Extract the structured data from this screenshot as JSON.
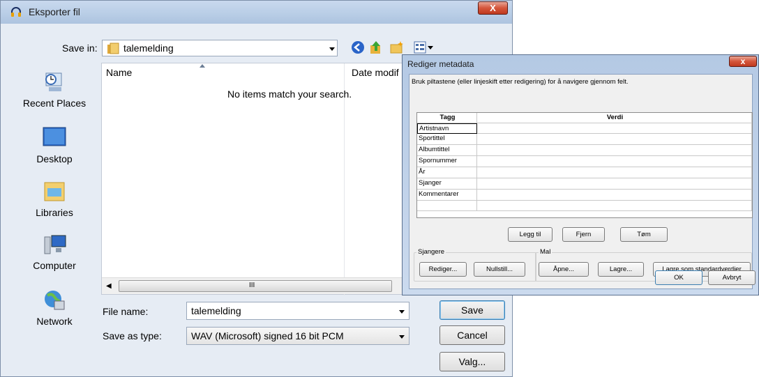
{
  "export_dialog": {
    "title": "Eksporter fil",
    "close_label": "X",
    "save_in_label": "Save in:",
    "save_in_value": "talemelding",
    "nav": [
      {
        "label": "Recent Places",
        "icon": "recent-places-icon"
      },
      {
        "label": "Desktop",
        "icon": "desktop-icon"
      },
      {
        "label": "Libraries",
        "icon": "libraries-icon"
      },
      {
        "label": "Computer",
        "icon": "computer-icon"
      },
      {
        "label": "Network",
        "icon": "network-icon"
      }
    ],
    "columns": {
      "name": "Name",
      "date": "Date modif"
    },
    "empty_message": "No items match your search.",
    "scroll_grip": "III",
    "file_name_label": "File name:",
    "file_name_value": "talemelding",
    "save_type_label": "Save as type:",
    "save_type_value": "WAV (Microsoft) signed 16 bit PCM",
    "save_button": "Save",
    "cancel_button": "Cancel",
    "options_button": "Valg..."
  },
  "metadata_dialog": {
    "title": "Rediger metadata",
    "close_label": "x",
    "instruction": "Bruk piltastene (eller linjeskift etter redigering) for å navigere gjennom felt.",
    "columns": {
      "tag": "Tagg",
      "value": "Verdi"
    },
    "rows": [
      {
        "tag": "Artistnavn",
        "value": ""
      },
      {
        "tag": "Sportittel",
        "value": ""
      },
      {
        "tag": "Albumtittel",
        "value": ""
      },
      {
        "tag": "Spornummer",
        "value": ""
      },
      {
        "tag": "År",
        "value": ""
      },
      {
        "tag": "Sjanger",
        "value": ""
      },
      {
        "tag": "Kommentarer",
        "value": ""
      },
      {
        "tag": "",
        "value": ""
      }
    ],
    "add_button": "Legg til",
    "remove_button": "Fjern",
    "clear_button": "Tøm",
    "genres_group": "Sjangere",
    "edit_button": "Rediger...",
    "reset_button": "Nullstill...",
    "template_group": "Mal",
    "open_button": "Åpne...",
    "save_button": "Lagre...",
    "save_default_button": "Lagre som standardverdier",
    "ok_button": "OK",
    "cancel_button": "Avbryt"
  },
  "colors": {
    "accent": "#3a7bd5",
    "close": "#c8452c"
  }
}
